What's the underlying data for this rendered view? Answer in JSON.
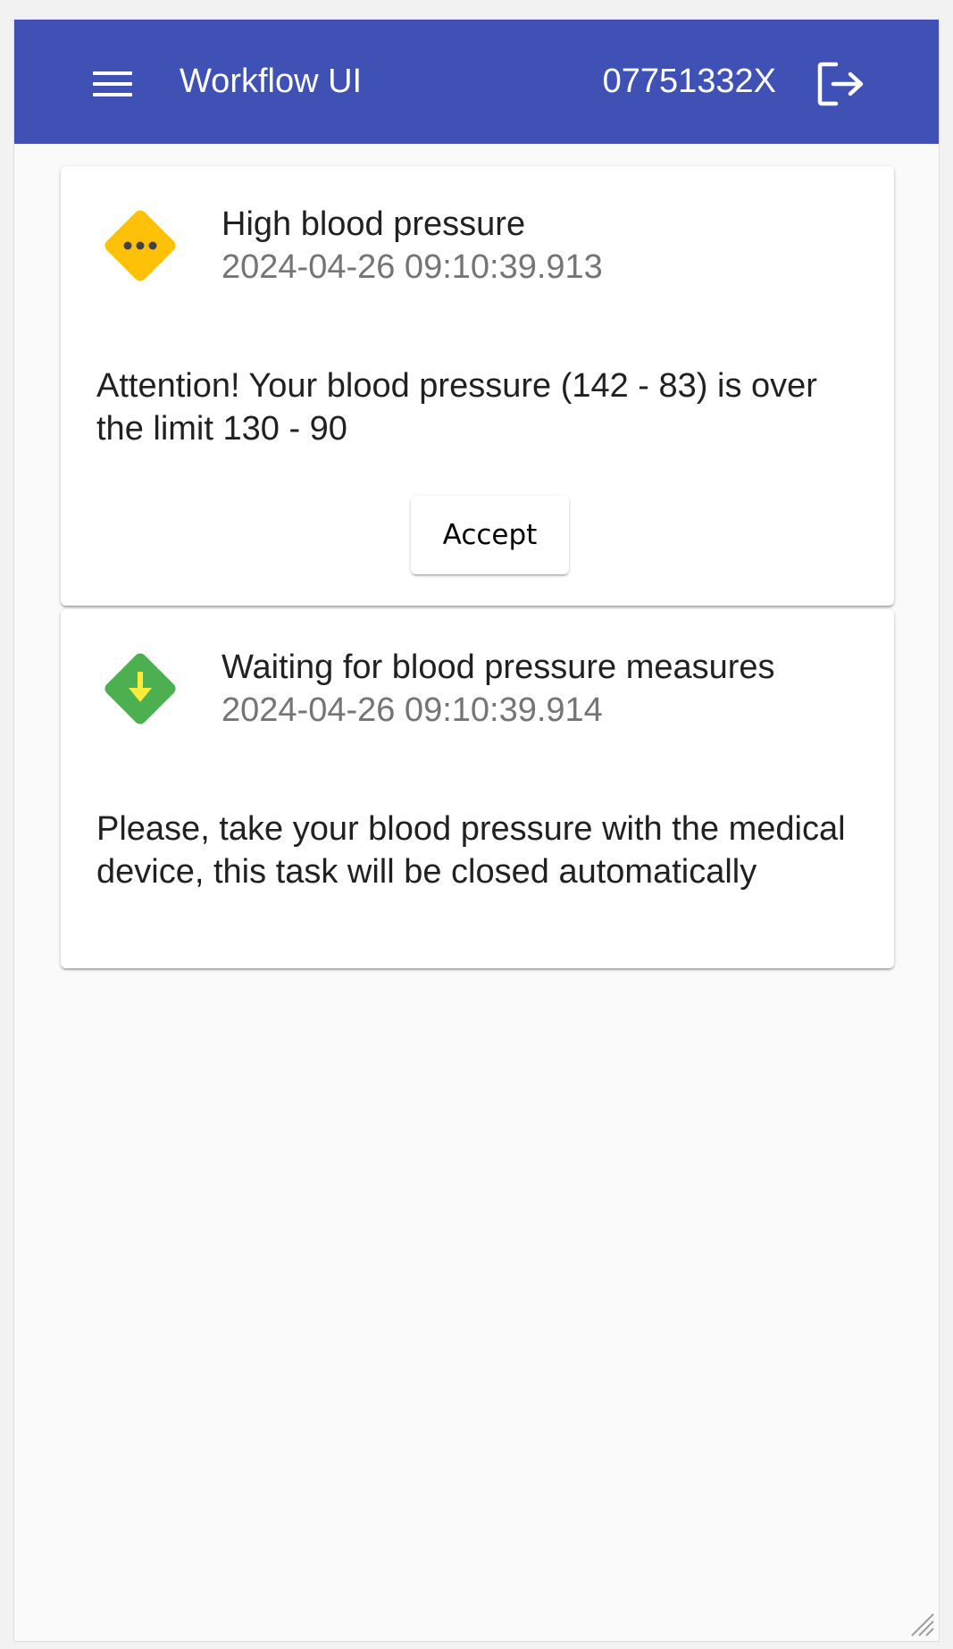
{
  "toolbar": {
    "title": "Workflow UI",
    "user_id": "07751332X",
    "background_color": "#3f51b5",
    "menu_icon": "menu-icon",
    "logout_icon": "logout-icon"
  },
  "tasks": [
    {
      "title": "High blood pressure",
      "timestamp": "2024-04-26 09:10:39.913",
      "message": "Attention! Your blood pressure (142 - 83) is over the limit 130 - 90",
      "icon": "pending-diamond-icon",
      "icon_color": "#ffc107",
      "action_label": "Accept"
    },
    {
      "title": "Waiting for blood pressure measures",
      "timestamp": "2024-04-26 09:10:39.914",
      "message": "Please, take your blood pressure with the medical device, this task will be closed automatically",
      "icon": "download-diamond-icon",
      "icon_color": "#4caf50"
    }
  ]
}
